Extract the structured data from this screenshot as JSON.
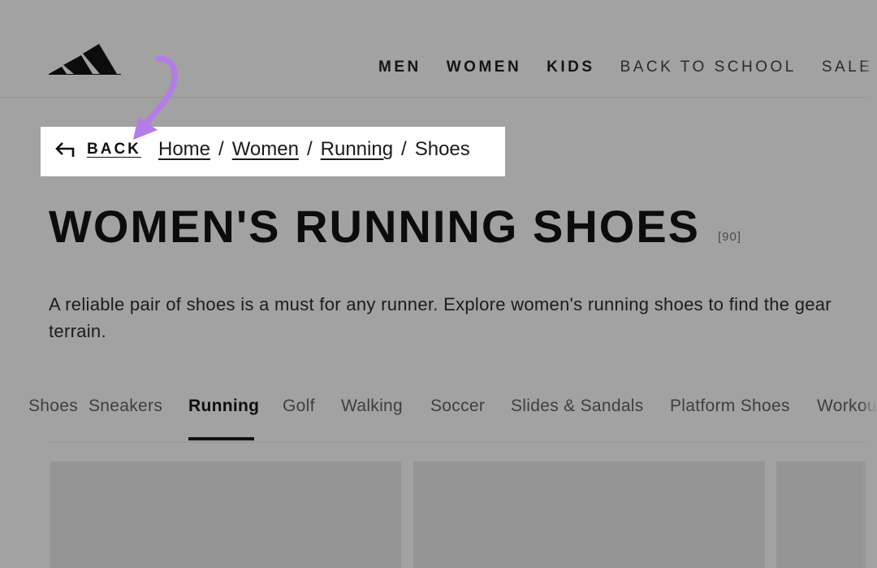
{
  "header": {
    "logo_icon": "adidas-logo-icon",
    "nav": [
      {
        "label": "MEN",
        "weight": "bold"
      },
      {
        "label": "WOMEN",
        "weight": "bold"
      },
      {
        "label": "KIDS",
        "weight": "bold"
      },
      {
        "label": "BACK TO SCHOOL",
        "weight": "light"
      },
      {
        "label": "SALE",
        "weight": "light"
      }
    ]
  },
  "breadcrumb": {
    "back_label": "BACK",
    "back_icon": "back-arrow-icon",
    "items": [
      {
        "label": "Home"
      },
      {
        "label": "Women"
      },
      {
        "label": "Running"
      },
      {
        "label": "Shoes"
      }
    ],
    "separator": "/"
  },
  "annotation": {
    "color": "#b57be8",
    "icon": "annotation-arrow-icon"
  },
  "page": {
    "title": "WOMEN'S RUNNING SHOES",
    "count": "[90]",
    "description": "A reliable pair of shoes is a must for any runner. Explore women's running shoes to find the gear terrain."
  },
  "tabs": {
    "items": [
      {
        "label": "Shoes"
      },
      {
        "label": "Sneakers"
      },
      {
        "label": "Running"
      },
      {
        "label": "Golf"
      },
      {
        "label": "Walking"
      },
      {
        "label": "Soccer"
      },
      {
        "label": "Slides & Sandals"
      },
      {
        "label": "Platform Shoes"
      },
      {
        "label": "Workout"
      }
    ],
    "active": "Running"
  },
  "colors": {
    "overlay_gray": "#a2a2a2",
    "breadcrumb_bg": "#ffffff",
    "text": "#111111"
  }
}
